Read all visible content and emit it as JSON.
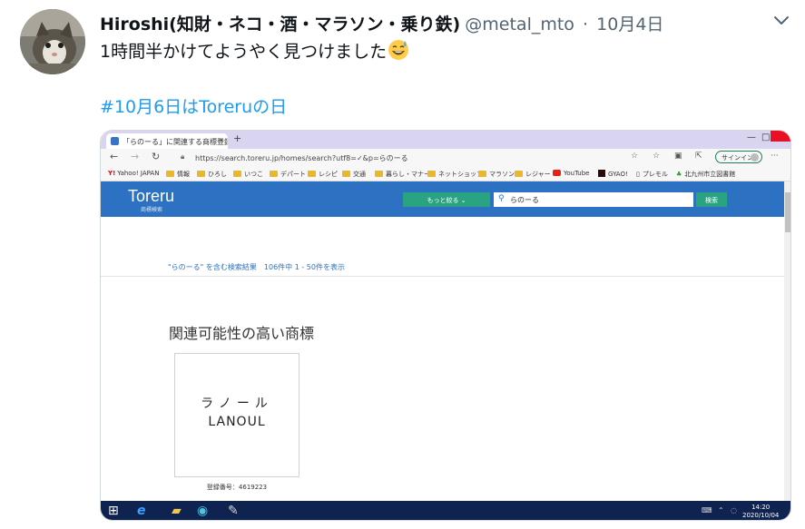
{
  "tweet": {
    "display_name": "Hiroshi(知財・ネコ・酒・マラソン・乗り鉄)",
    "handle": "@metal_mto",
    "separator": "·",
    "date": "10月4日",
    "text": "1時間半かけてようやく見つけました",
    "emoji": "grinning-face-with-sweat-icon",
    "hashtag": "#10月6日はToreruの日"
  },
  "screenshot": {
    "tab_title": "「らのーる」に関連する商標登録一覧",
    "tab_close": "×",
    "new_tab": "+",
    "window_controls": [
      "—",
      "□"
    ],
    "url": "https://search.toreru.jp/homes/search?utf8=✓&p=らのーる",
    "signin_label": "サインイン",
    "bookmarks": [
      "Yahoo! JAPAN",
      "情報",
      "ひろし",
      "いつこ",
      "デパート",
      "レシピ",
      "交通",
      "暮らし・マナー",
      "ネットショップ",
      "マラソン",
      "レジャー",
      "YouTube",
      "GYAO!",
      "プレモル",
      "北九州市立図書館"
    ],
    "site": {
      "logo": "Toreru",
      "logo_sub": "商標検索",
      "narrow_button": "もっと絞る ⌄",
      "search_value": "らのーる",
      "search_button": "検索"
    },
    "results_line": "\"らのーる\" を含む検索結果　106件中 1 - 50件を表示",
    "section_title": "関連可能性の高い商標",
    "mark": {
      "text_jp": "ラノール",
      "text_en": "LANOUL",
      "registration": "登録番号：4619223"
    },
    "taskbar": {
      "time": "14:20",
      "date": "2020/10/04"
    }
  },
  "colors": {
    "link": "#1d9bf0",
    "toreru_blue": "#2d72c2",
    "toreru_green": "#2aa383",
    "taskbar": "#0f2350"
  }
}
